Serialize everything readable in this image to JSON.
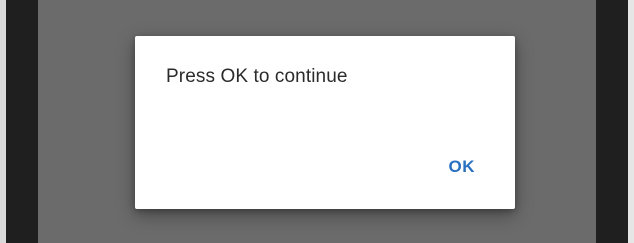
{
  "dialog": {
    "message": "Press OK to continue",
    "ok_label": "OK"
  },
  "colors": {
    "overlay": "#6b6b6b",
    "bezel": "#1f1f1f",
    "dialog_background": "#ffffff",
    "message_text": "#2b2b2b",
    "ok_text": "#2a6fc0"
  }
}
